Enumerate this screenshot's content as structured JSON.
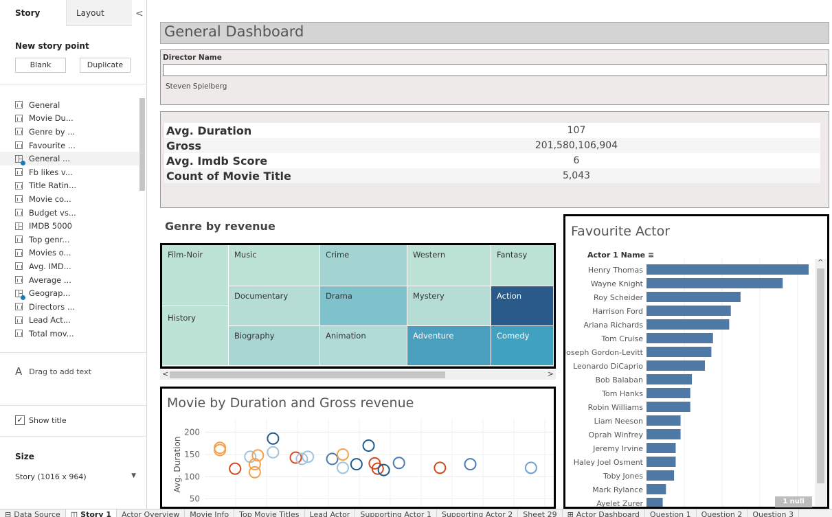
{
  "left_panel": {
    "tabs": [
      "Story",
      "Layout"
    ],
    "collapse_glyph": "<",
    "new_story_point": "New story point",
    "blank_btn": "Blank",
    "duplicate_btn": "Duplicate",
    "story_points": [
      {
        "label": "General",
        "icon": "bar"
      },
      {
        "label": "Movie Du...",
        "icon": "bar"
      },
      {
        "label": "Genre by ...",
        "icon": "bar"
      },
      {
        "label": "Favourite ...",
        "icon": "bar"
      },
      {
        "label": "General ...",
        "icon": "dashboard",
        "selected": true
      },
      {
        "label": "Fb likes v...",
        "icon": "bar"
      },
      {
        "label": "Title Ratin...",
        "icon": "bar"
      },
      {
        "label": "Movie co...",
        "icon": "bar"
      },
      {
        "label": "Budget vs...",
        "icon": "bar"
      },
      {
        "label": "IMDB 5000",
        "icon": "dashboard"
      },
      {
        "label": "Top genr...",
        "icon": "bar"
      },
      {
        "label": "Movies o...",
        "icon": "bar"
      },
      {
        "label": "Avg. IMD...",
        "icon": "bar"
      },
      {
        "label": "Average ...",
        "icon": "bar"
      },
      {
        "label": "Geograp...",
        "icon": "dashboard"
      },
      {
        "label": "Directors ...",
        "icon": "bar"
      },
      {
        "label": "Lead Act...",
        "icon": "bar"
      },
      {
        "label": "Total mov...",
        "icon": "bar"
      }
    ],
    "drag_text": "Drag to add text",
    "show_title": "Show title",
    "show_title_checked": "✓",
    "size_label": "Size",
    "size_value": "Story (1016 x 964)"
  },
  "dashboard": {
    "title": "General Dashboard",
    "filter": {
      "label": "Director Name",
      "value": "Steven Spielberg"
    },
    "kpis": [
      {
        "label": "Avg. Duration",
        "value": "107"
      },
      {
        "label": "Gross",
        "value": "201,580,106,904"
      },
      {
        "label": "Avg. Imdb Score",
        "value": "6"
      },
      {
        "label": "Count of Movie Title",
        "value": "5,043"
      }
    ],
    "treemap": {
      "title": "Genre by revenue",
      "cells": [
        {
          "label": "Film-Noir",
          "color": "#bde3d6"
        },
        {
          "label": "History",
          "color": "#bde3d6"
        },
        {
          "label": "Music",
          "color": "#bde3d6"
        },
        {
          "label": "Documentary",
          "color": "#b5ddd6"
        },
        {
          "label": "Biography",
          "color": "#a8d6d3"
        },
        {
          "label": "Crime",
          "color": "#a3d4d2"
        },
        {
          "label": "Drama",
          "color": "#7fc2cb"
        },
        {
          "label": "Animation",
          "color": "#b0dbd6"
        },
        {
          "label": "Western",
          "color": "#bde3d6"
        },
        {
          "label": "Mystery",
          "color": "#b5ddd6"
        },
        {
          "label": "Adventure",
          "color": "#4a9fbf"
        },
        {
          "label": "Fantasy",
          "color": "#bde3d6"
        },
        {
          "label": "Action",
          "color": "#2a5a8a"
        },
        {
          "label": "Comedy",
          "color": "#41a1c0"
        }
      ]
    },
    "scatter": {
      "title": "Movie by Duration and Gross revenue",
      "ylabel": "Avg. Duration",
      "yticks": [
        "200",
        "150",
        "100",
        "50"
      ],
      "ylim": [
        40,
        215
      ]
    },
    "favourite_actor": {
      "title": "Favourite Actor",
      "header": "Actor 1 Name",
      "null_badge": "1 null"
    }
  },
  "chart_data": [
    {
      "type": "scatter",
      "title": "Movie by Duration and Gross revenue",
      "ylabel": "Avg. Duration",
      "ylim": [
        40,
        215
      ],
      "points": [
        {
          "x": 1,
          "y": 165,
          "color": "#f5a04a"
        },
        {
          "x": 1,
          "y": 160,
          "color": "#f5a04a"
        },
        {
          "x": 2,
          "y": 118,
          "color": "#d04a1d"
        },
        {
          "x": 3,
          "y": 145,
          "color": "#9fc3dd"
        },
        {
          "x": 3.3,
          "y": 128,
          "color": "#f5a04a"
        },
        {
          "x": 3.3,
          "y": 110,
          "color": "#f5a04a"
        },
        {
          "x": 3.5,
          "y": 148,
          "color": "#f5a04a"
        },
        {
          "x": 4.5,
          "y": 186,
          "color": "#1f5a8a"
        },
        {
          "x": 4.5,
          "y": 155,
          "color": "#9fc3dd"
        },
        {
          "x": 6,
          "y": 143,
          "color": "#d04a1d"
        },
        {
          "x": 6.4,
          "y": 140,
          "color": "#9fc3dd"
        },
        {
          "x": 6.8,
          "y": 145,
          "color": "#9fc3dd"
        },
        {
          "x": 8.4,
          "y": 140,
          "color": "#4a7ab0"
        },
        {
          "x": 9.1,
          "y": 150,
          "color": "#f5a04a"
        },
        {
          "x": 9.1,
          "y": 120,
          "color": "#9fc3dd"
        },
        {
          "x": 10,
          "y": 128,
          "color": "#1f5a8a"
        },
        {
          "x": 10.8,
          "y": 170,
          "color": "#1f5a8a"
        },
        {
          "x": 11.2,
          "y": 130,
          "color": "#d04a1d"
        },
        {
          "x": 11.4,
          "y": 118,
          "color": "#d04a1d"
        },
        {
          "x": 11.8,
          "y": 115,
          "color": "#1f5a8a"
        },
        {
          "x": 12.8,
          "y": 131,
          "color": "#4a7ab0"
        },
        {
          "x": 15.5,
          "y": 120,
          "color": "#d04a1d"
        },
        {
          "x": 17.5,
          "y": 128,
          "color": "#4a7ab0"
        },
        {
          "x": 21.5,
          "y": 120,
          "color": "#6fa0cf"
        }
      ]
    },
    {
      "type": "bar",
      "title": "Favourite Actor",
      "xlabel": "",
      "ylabel": "Actor 1 Name",
      "categories": [
        "Henry Thomas",
        "Wayne Knight",
        "Roy Scheider",
        "Harrison Ford",
        "Ariana Richards",
        "Tom Cruise",
        "Joseph Gordon-Levitt",
        "Leonardo DiCaprio",
        "Bob Balaban",
        "Tom Hanks",
        "Robin Williams",
        "Liam Neeson",
        "Oprah Winfrey",
        "Jeremy Irvine",
        "Haley Joel Osment",
        "Toby Jones",
        "Mark Rylance",
        "Ayelet Zurer"
      ],
      "values": [
        100,
        84,
        58,
        52,
        51,
        41,
        40,
        36,
        28,
        27,
        27,
        21,
        21,
        18,
        18,
        17,
        12,
        10
      ],
      "bar_color": "#4e79a7"
    }
  ],
  "bottom_tabs": [
    {
      "label": "Data Source",
      "icon": "⊟"
    },
    {
      "label": "Story 1",
      "icon": "◫",
      "active": true
    },
    {
      "label": "Actor Overview"
    },
    {
      "label": "Movie Info"
    },
    {
      "label": "Top Movie Titles"
    },
    {
      "label": "Lead Actor"
    },
    {
      "label": "Supporting Actor 1"
    },
    {
      "label": "Supporting Actor 2"
    },
    {
      "label": "Sheet 29"
    },
    {
      "label": "Actor Dashboard",
      "icon": "⊞"
    },
    {
      "label": "Question 1"
    },
    {
      "label": "Question 2"
    },
    {
      "label": "Question 3"
    }
  ]
}
